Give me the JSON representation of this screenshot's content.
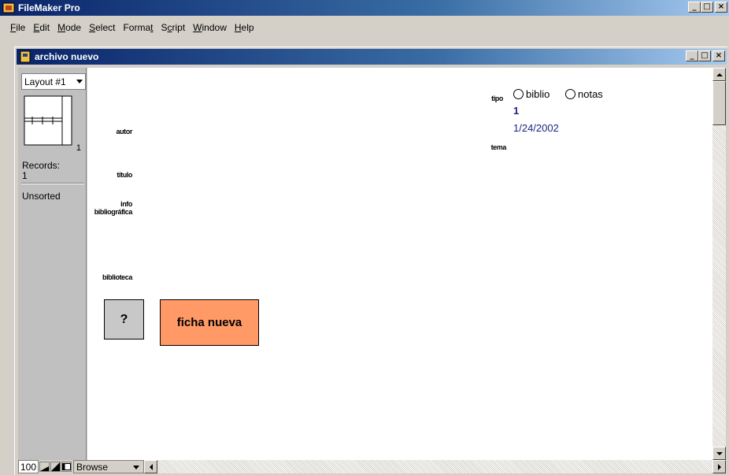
{
  "app": {
    "title": "FileMaker Pro",
    "window_buttons": {
      "minimize": "_",
      "maximize": "□",
      "close": "×"
    }
  },
  "menubar": {
    "items": [
      {
        "label": "File",
        "accel": "F",
        "rest": "ile"
      },
      {
        "label": "Edit",
        "accel": "E",
        "rest": "dit"
      },
      {
        "label": "Mode",
        "accel": "M",
        "rest": "ode"
      },
      {
        "label": "Select",
        "accel": "S",
        "rest": "elect"
      },
      {
        "label": "Format",
        "pre": "Forma",
        "accel": "t",
        "rest": ""
      },
      {
        "label": "Script",
        "pre": "S",
        "accel": "c",
        "rest": "ript"
      },
      {
        "label": "Window",
        "accel": "W",
        "rest": "indow"
      },
      {
        "label": "Help",
        "accel": "H",
        "rest": "elp"
      }
    ]
  },
  "document": {
    "title": "archivo nuevo"
  },
  "status_area": {
    "layout_label": "Layout #1",
    "book_page": "1",
    "records_label": "Records:",
    "records_count": "1",
    "sort_status": "Unsorted"
  },
  "layout": {
    "labels": {
      "autor": "autor",
      "titulo": "título",
      "info_line1": "info",
      "info_line2": "bibliográfica",
      "biblioteca": "biblioteca",
      "tipo": "tipo",
      "tema": "tema"
    },
    "tipo_options": [
      "biblio",
      "notas"
    ],
    "record_number": "1",
    "date": "1/24/2002",
    "help_button": "?",
    "new_record_button": "ficha nueva"
  },
  "bottom_bar": {
    "zoom": "100",
    "mode": "Browse"
  },
  "colors": {
    "titlebar_start": "#0a246a",
    "titlebar_end": "#a6caf0",
    "new_button": "#ff9966",
    "value_text": "#1a237e"
  }
}
